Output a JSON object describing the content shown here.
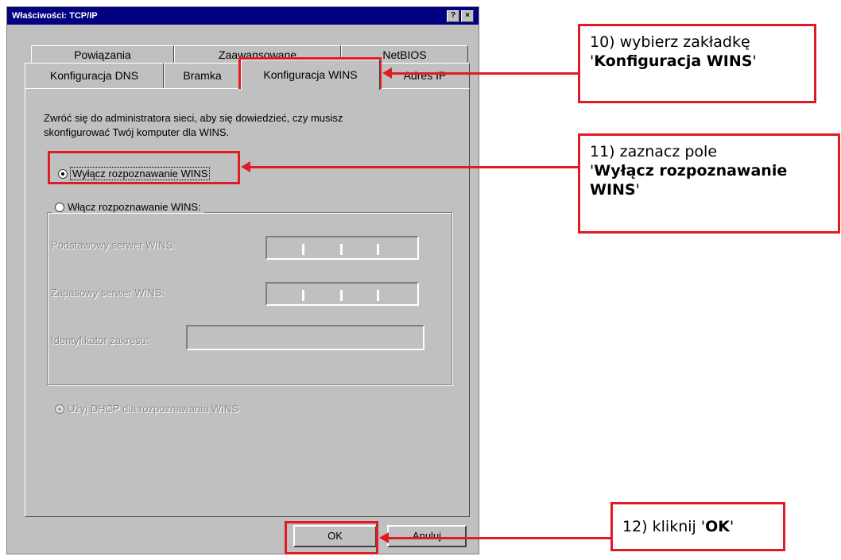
{
  "window": {
    "title": "Właściwości: TCP/IP",
    "help_btn": "?",
    "close_btn": "×"
  },
  "tabs": {
    "row1": [
      "Powiązania",
      "Zaawansowane",
      "NetBIOS"
    ],
    "row2": [
      "Konfiguracja DNS",
      "Bramka",
      "Konfiguracja WINS",
      "Adres IP"
    ]
  },
  "panel": {
    "intro_line1": "Zwróć się do administratora sieci, aby się dowiedzieć, czy musisz",
    "intro_line2": "skonfigurować Twój komputer dla WINS.",
    "radio_disable": "Wyłącz rozpoznawanie WINS",
    "radio_enable": "Włącz rozpoznawanie WINS:",
    "primary_label": "Podstawowy serwer WINS:",
    "secondary_label": "Zapasowy serwer WINS:",
    "scope_label": "Identyfikator zakresu:",
    "radio_dhcp": "Użyj DHCP dla rozpoznawania WINS"
  },
  "buttons": {
    "ok": "OK",
    "cancel": "Anuluj"
  },
  "callouts": {
    "step10_prefix": "10) wybierz zakładkę",
    "step10_bold": "Konfiguracja WINS",
    "step11_prefix": "11) zaznacz pole",
    "step11_bold": "Wyłącz rozpoznawanie WINS",
    "step12_prefix": "12) kliknij",
    "step12_bold": "OK"
  },
  "colors": {
    "annotation_red": "#e01b24",
    "titlebar": "#000080",
    "dialog_bg": "#c0c0c0"
  }
}
